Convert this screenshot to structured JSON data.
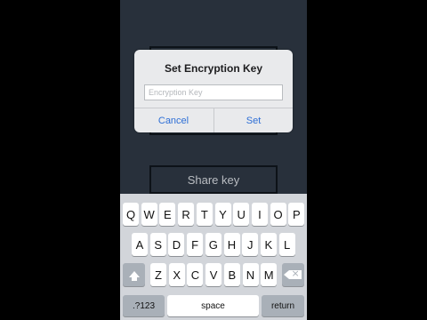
{
  "dialog": {
    "title": "Set Encryption Key",
    "input_placeholder": "Encryption Key",
    "input_value": "",
    "cancel_label": "Cancel",
    "set_label": "Set"
  },
  "background": {
    "share_label": "Share key"
  },
  "keyboard": {
    "row1": [
      "Q",
      "W",
      "E",
      "R",
      "T",
      "Y",
      "U",
      "I",
      "O",
      "P"
    ],
    "row2": [
      "A",
      "S",
      "D",
      "F",
      "G",
      "H",
      "J",
      "K",
      "L"
    ],
    "row3": [
      "Z",
      "X",
      "C",
      "V",
      "B",
      "N",
      "M"
    ],
    "numbers_label": ".?123",
    "space_label": "space",
    "return_label": "return",
    "shift_icon": "shift-icon",
    "delete_icon": "delete-icon"
  },
  "colors": {
    "background": "#2c3541",
    "accent": "#2e6fd6",
    "keyboard": "#d2d5da"
  }
}
